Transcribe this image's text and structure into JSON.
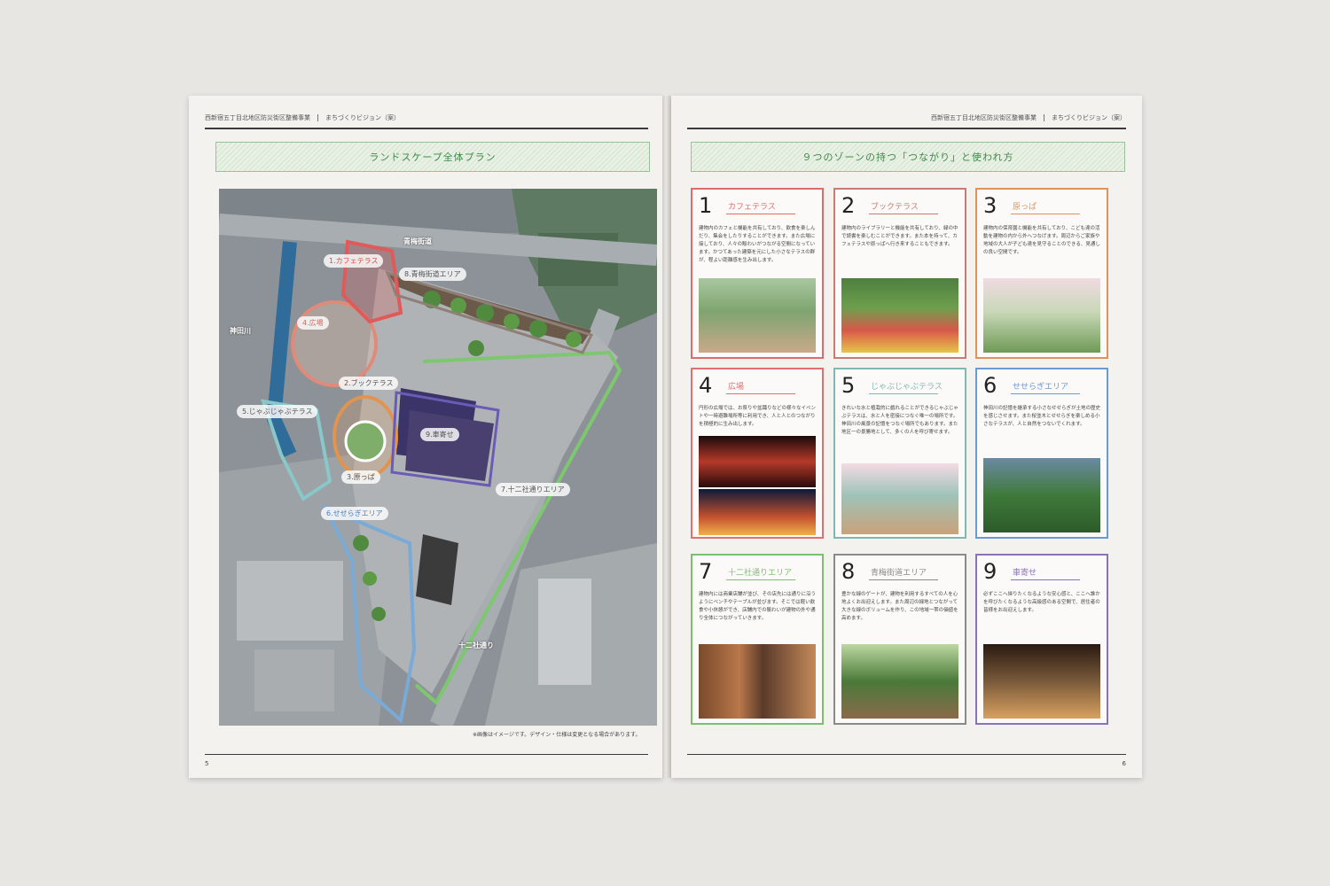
{
  "left_page": {
    "header": {
      "project": "西新宿五丁目北地区防災街区整備事業",
      "vision": "まちづくりビジョン（案）"
    },
    "title": "ランドスケープ全体プラン",
    "map_labels": {
      "z1": "1.カフェテラス",
      "z2": "2.ブックテラス",
      "z3": "3.原っぱ",
      "z4": "4.広場",
      "z5": "5.じゃぶじゃぶテラス",
      "z6": "6.せせらぎエリア",
      "z7": "7.十二社通りエリア",
      "z8": "8.青梅街道エリア",
      "z9": "9.車寄せ",
      "road_ome": "青梅街道",
      "river": "神田川",
      "road_junisou": "十二社通り"
    },
    "note": "※画像はイメージです。デザイン・仕様は変更となる場合があります。",
    "page_number": "5"
  },
  "right_page": {
    "header": {
      "project": "西新宿五丁目北地区防災街区整備事業",
      "vision": "まちづくりビジョン（案）"
    },
    "title": "９つのゾーンの持つ「つながり」と使われ方",
    "page_number": "6",
    "zones": [
      {
        "num": "1",
        "title": "カフェテラス",
        "color": "#e06a6a",
        "desc": "建物内のカフェと機能を共有しており、飲食を楽しんだり、集会をしたりすることができます。また広場に接しており、人々の賑わいがつながる空間になっています。かつてあった建築を元にした小さなテラスの群が、程よい距離感を生み出します。"
      },
      {
        "num": "2",
        "title": "ブックテラス",
        "color": "#c97a72",
        "desc": "建物内のライブラリーと機能を共有しており、緑の中で読書を楽しむことができます。また本を持って、カフェテラスや原っぱへ行き来することもできます。"
      },
      {
        "num": "3",
        "title": "原っぱ",
        "color": "#e0925a",
        "desc": "建物内の保育園と機能を共有しており、こども達の活動を建物の内から外へつなげます。周辺からご家族や地域の大人が子ども達を見守ることのできる、見通しの良い空間です。"
      },
      {
        "num": "4",
        "title": "広場",
        "color": "#e07070",
        "desc": "円形の広場では、お祭りや盆踊りなどの様々なイベントや一時避難場所等に利用でき、人と人とのつながりを積極的に生み出します。"
      },
      {
        "num": "5",
        "title": "じゃぶじゃぶテラス",
        "color": "#7fb8b0",
        "desc": "きれいな水と植栽的に戯れることができるじゃぶじゃぶテラスは、水と人を密接につなぐ唯一の場所です。神田川の風景の記憶をつなぐ場所でもあります。また地区一の景勝地として、多くの人を呼び寄せます。"
      },
      {
        "num": "6",
        "title": "せせらぎエリア",
        "color": "#6a9bd0",
        "desc": "神田川の記憶を継承する小さなせせらぎが土地の歴史を感じさせます。また桜並木とせせらぎを楽しめる小さなテラスが、人と自然をつないでくれます。"
      },
      {
        "num": "7",
        "title": "十二社通りエリア",
        "color": "#7cbf70",
        "desc": "建物内には商業店舗が並び、その店先には通りに沿うようにベンチやテーブルが並びます。そこでは軽い飲食や小休憩ができ、店舗内での賑わいが建物の外や通り全体につながっていきます。"
      },
      {
        "num": "8",
        "title": "青梅街道エリア",
        "color": "#8a8a8a",
        "desc": "豊かな緑のゲートが、建物を利用するすべての人を心地よくお出迎えします。また周辺の緑地とつながって大きな緑のボリュームを作り、この地域一帯の価値を高めます。"
      },
      {
        "num": "9",
        "title": "車寄せ",
        "color": "#8a72b5",
        "desc": "必ずここへ帰りたくなるような安心感と、ここへ誰かを呼びたくなるような高級感のある空間で、居住者の皆様をお出迎えします。"
      }
    ]
  }
}
